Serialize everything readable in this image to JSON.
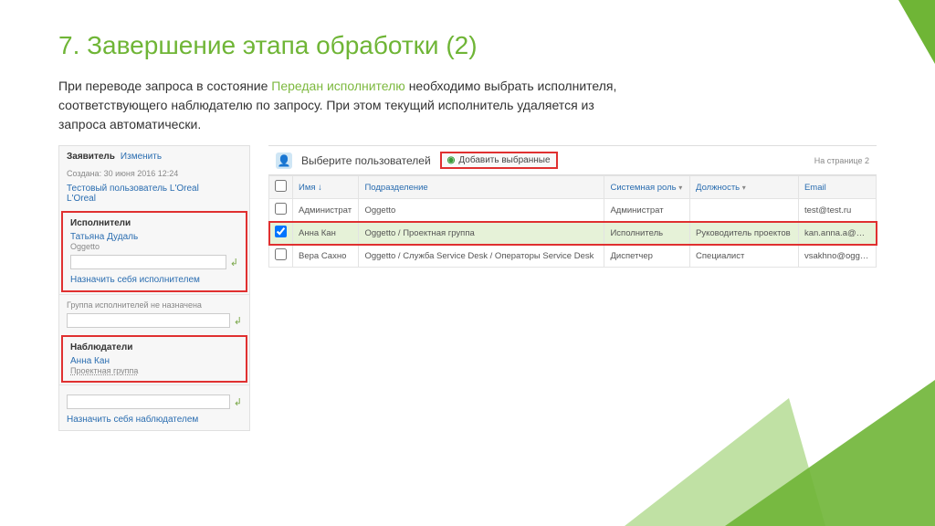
{
  "title": "7. Завершение этапа обработки (2)",
  "desc_pre": "При переводе запроса в состояние ",
  "desc_hl": "Передан исполнителю",
  "desc_post": " необходимо выбрать исполнителя, соответствующего наблюдателю по запросу. При этом текущий исполнитель удаляется из запроса автоматически.",
  "left": {
    "applicant_label": "Заявитель",
    "change_link": "Изменить",
    "created": "Создана: 30 июня 2016 12:24",
    "test_user": "Тестовый пользователь L'Oreal",
    "loreal": "L'Oreal",
    "executors_label": "Исполнители",
    "executor_name": "Татьяна Дудаль",
    "executor_org": "Oggetto",
    "assign_self_exec": "Назначить себя исполнителем",
    "group_unassigned": "Группа исполнителей не назначена",
    "observers_label": "Наблюдатели",
    "observer_name": "Анна Кан",
    "observer_group": "Проектная группа",
    "assign_self_obs": "Назначить себя наблюдателем"
  },
  "right": {
    "choose_users": "Выберите пользователей",
    "add_selected": "Добавить выбранные",
    "per_page": "На странице 2",
    "cols": {
      "name": "Имя ↓",
      "dept": "Подразделение",
      "role": "Системная роль",
      "position": "Должность",
      "email": "Email"
    },
    "rows": [
      {
        "name": "Администрат",
        "dept": "Oggetto",
        "role": "Администрат",
        "position": "",
        "email": "test@test.ru"
      },
      {
        "name": "Анна Кан",
        "dept": "Oggetto / Проектная группа",
        "role": "Исполнитель",
        "position": "Руководитель проектов",
        "email": "kan.anna.a@…"
      },
      {
        "name": "Вера Сахно",
        "dept": "Oggetto / Служба Service Desk / Операторы Service Desk",
        "role": "Диспетчер",
        "position": "Специалист",
        "email": "vsakhno@ogg…"
      }
    ]
  }
}
